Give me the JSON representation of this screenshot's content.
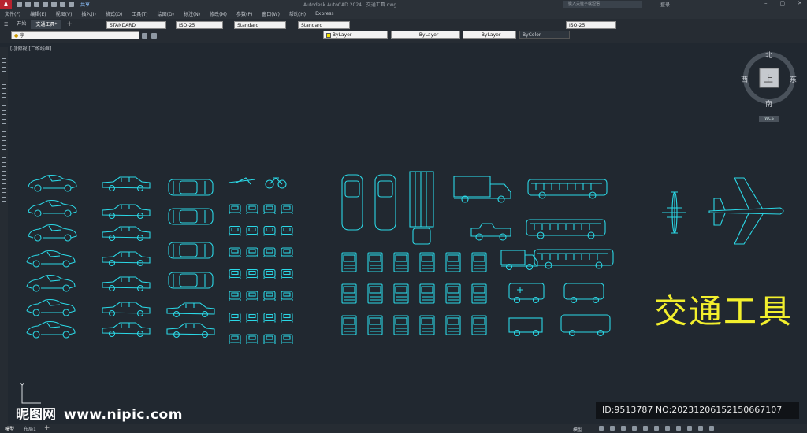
{
  "app": {
    "logo": "A",
    "title": "Autodesk AutoCAD 2024",
    "filename": "交通工具.dwg",
    "share": "共享",
    "search_placeholder": "键入关键字或短语",
    "login": "登录"
  },
  "menu": [
    "文件(F)",
    "编辑(E)",
    "视图(V)",
    "插入(I)",
    "格式(O)",
    "工具(T)",
    "绘图(D)",
    "标注(N)",
    "修改(M)",
    "参数(P)",
    "窗口(W)",
    "帮助(H)",
    "Express"
  ],
  "tabs": [
    {
      "label": "开始"
    },
    {
      "label": "交通工具*"
    }
  ],
  "toolbar": {
    "textstyle": "STANDARD",
    "dimstyle": "ISO-25",
    "tablestyle": "Standard",
    "mleaderstyle": "Standard",
    "layer_value": "字",
    "color": "ByLayer",
    "linetype": "ByLayer",
    "lineweight": "ByLayer",
    "plotstyle": "ByColor",
    "dimstyle2": "ISO-25"
  },
  "viewport": {
    "label": "[-][俯视][二维线框]"
  },
  "viewcube": {
    "north": "北",
    "south": "南",
    "east": "东",
    "west": "西",
    "face": "上",
    "wcs": "WCS"
  },
  "ucs": {
    "y_label": "Y"
  },
  "drawing": {
    "title_text": "交通工具"
  },
  "watermark": {
    "site": "昵图网",
    "url": "www.nipic.com",
    "id_text": "ID:9513787 NO:20231206152150667107"
  },
  "status": {
    "model_tab": "模型",
    "layout_tab": "布局1",
    "model_button": "模型"
  },
  "colors": {
    "accent": "#2bd8e6",
    "title_yellow": "#f2ef2d",
    "bg": "#212830"
  }
}
